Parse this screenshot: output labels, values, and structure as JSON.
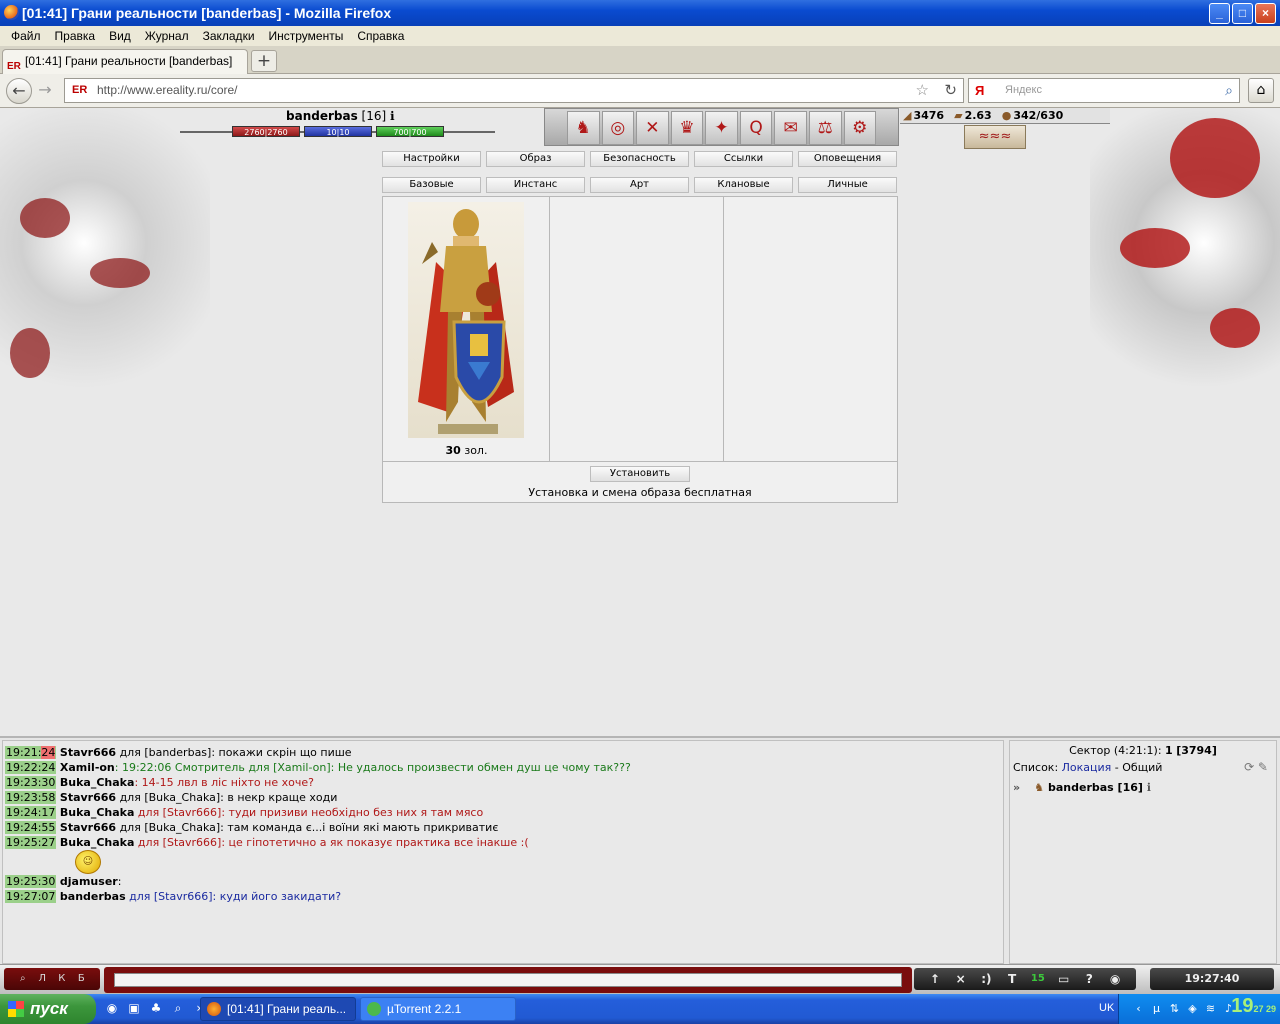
{
  "window": {
    "title": "[01:41] Грани реальности [banderbas] - Mozilla Firefox"
  },
  "menu": [
    "Файл",
    "Правка",
    "Вид",
    "Журнал",
    "Закладки",
    "Инструменты",
    "Справка"
  ],
  "browser": {
    "tab_title": "[01:41] Грани реальности [banderbas]",
    "url": "http://www.ereality.ru/core/",
    "search_placeholder": "Яндекс"
  },
  "game": {
    "char_name": "banderbas",
    "char_level": "[16]",
    "hp": "2760|2760",
    "mp": "10|10",
    "stamina": "700|700",
    "hp_fraction": 1.0,
    "mp_fraction": 1.0,
    "stamina_fraction": 1.0,
    "stats": {
      "v1": "3476",
      "v2": "2.63",
      "v3": "342/630"
    },
    "nav_row1": [
      "Настройки",
      "Образ",
      "Безопасность",
      "Ссылки",
      "Оповещения"
    ],
    "nav_row2": [
      "Базовые",
      "Инстанс",
      "Арт",
      "Клановые",
      "Личные"
    ],
    "price_value": "30",
    "price_unit": "зол.",
    "install_button": "Установить",
    "install_note": "Установка и смена образа бесплатная"
  },
  "chat": {
    "messages": [
      {
        "time_main": "19:21:",
        "time_sec": "24",
        "user": "Stavr666",
        "rest": " для [banderbas]: покажи скрін що пише",
        "color": "black"
      },
      {
        "time_main": "19:22:24",
        "time_sec": "",
        "user": "Xamil-on",
        "rest": ": 19:22:06 Смотритель для [Xamil-on]: Не удалось произвести обмен душ це чому так???",
        "color": "green"
      },
      {
        "time_main": "19:23:30",
        "time_sec": "",
        "user": "Buka_Chaka",
        "rest": ": 14-15 лвл в ліс ніхто не хоче?",
        "color": "red"
      },
      {
        "time_main": "19:23:58",
        "time_sec": "",
        "user": "Stavr666",
        "rest": " для [Buka_Chaka]: в некр краще ходи",
        "color": "black"
      },
      {
        "time_main": "19:24:17",
        "time_sec": "",
        "user": "Buka_Chaka",
        "rest": " для [Stavr666]: туди призиви необхідно без них я там мясо",
        "color": "red"
      },
      {
        "time_main": "19:24:55",
        "time_sec": "",
        "user": "Stavr666",
        "rest": " для [Buka_Chaka]: там команда є...і воїни які мають прикриватиє",
        "color": "black"
      },
      {
        "time_main": "19:25:27",
        "time_sec": "",
        "user": "Buka_Chaka",
        "rest": " для [Stavr666]: це гіпотетично а як показує практика все інакше :(",
        "color": "red"
      },
      {
        "time_main": "19:25:30",
        "time_sec": "",
        "user": "djamuser",
        "rest": ":",
        "color": "black"
      },
      {
        "time_main": "19:27:07",
        "time_sec": "",
        "user": "banderbas",
        "rest": " для [Stavr666]: куди його закидати?",
        "color": "blue"
      }
    ]
  },
  "sidebar": {
    "sector": "Сектор (4:21:1):",
    "sector_count": "1",
    "sector_id": "[3794]",
    "list_label": "Список:",
    "list_link": "Локация",
    "list_rest": "- Общий",
    "user": "banderbas [16]"
  },
  "inputbar": {
    "left_buttons": [
      "Л",
      "К",
      "Б"
    ],
    "tools": [
      "T",
      "15",
      "?"
    ],
    "time": "19:27:40"
  },
  "taskbar": {
    "start": "пуск",
    "task1": "[01:41] Грани реаль...",
    "task2": "µTorrent 2.2.1",
    "lang": "UK",
    "clock_hm": "19",
    "clock_min": "27",
    "clock_sec": "29"
  }
}
